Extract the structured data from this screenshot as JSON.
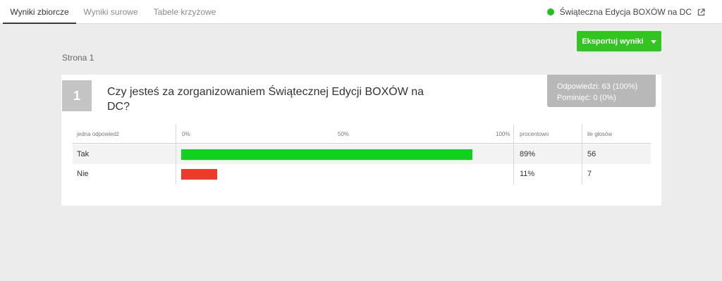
{
  "tabs": [
    {
      "label": "Wyniki zbiorcze",
      "active": true
    },
    {
      "label": "Wyniki surowe",
      "active": false
    },
    {
      "label": "Tabele krzyżowe",
      "active": false
    }
  ],
  "survey": {
    "title": "Świąteczna Edycja BOXÓW na DC",
    "status_color": "#1ec31e",
    "icon": "external-link-icon"
  },
  "export_button": {
    "label": "Eksportuj wyniki",
    "color": "#32c51f"
  },
  "page_label": "Strona 1",
  "question": {
    "number": "1",
    "text": "Czy jesteś za zorganizowaniem Świątecznej Edycji BOXÓW na DC?",
    "answered": "Odpowiedzi: 63 (100%)",
    "skipped": "Pominięć: 0 (0%)"
  },
  "table": {
    "headers": {
      "answer": "jedna odpowiedź",
      "scale_0": "0%",
      "scale_50": "50%",
      "scale_100": "100%",
      "percent": "procentowo",
      "votes": "ile głosów"
    },
    "rows": [
      {
        "label": "Tak",
        "fraction": 0.89,
        "percent": "89%",
        "votes": "56",
        "color": "#11d11f"
      },
      {
        "label": "Nie",
        "fraction": 0.11,
        "percent": "11%",
        "votes": "7",
        "color": "#ee3a26"
      }
    ]
  }
}
